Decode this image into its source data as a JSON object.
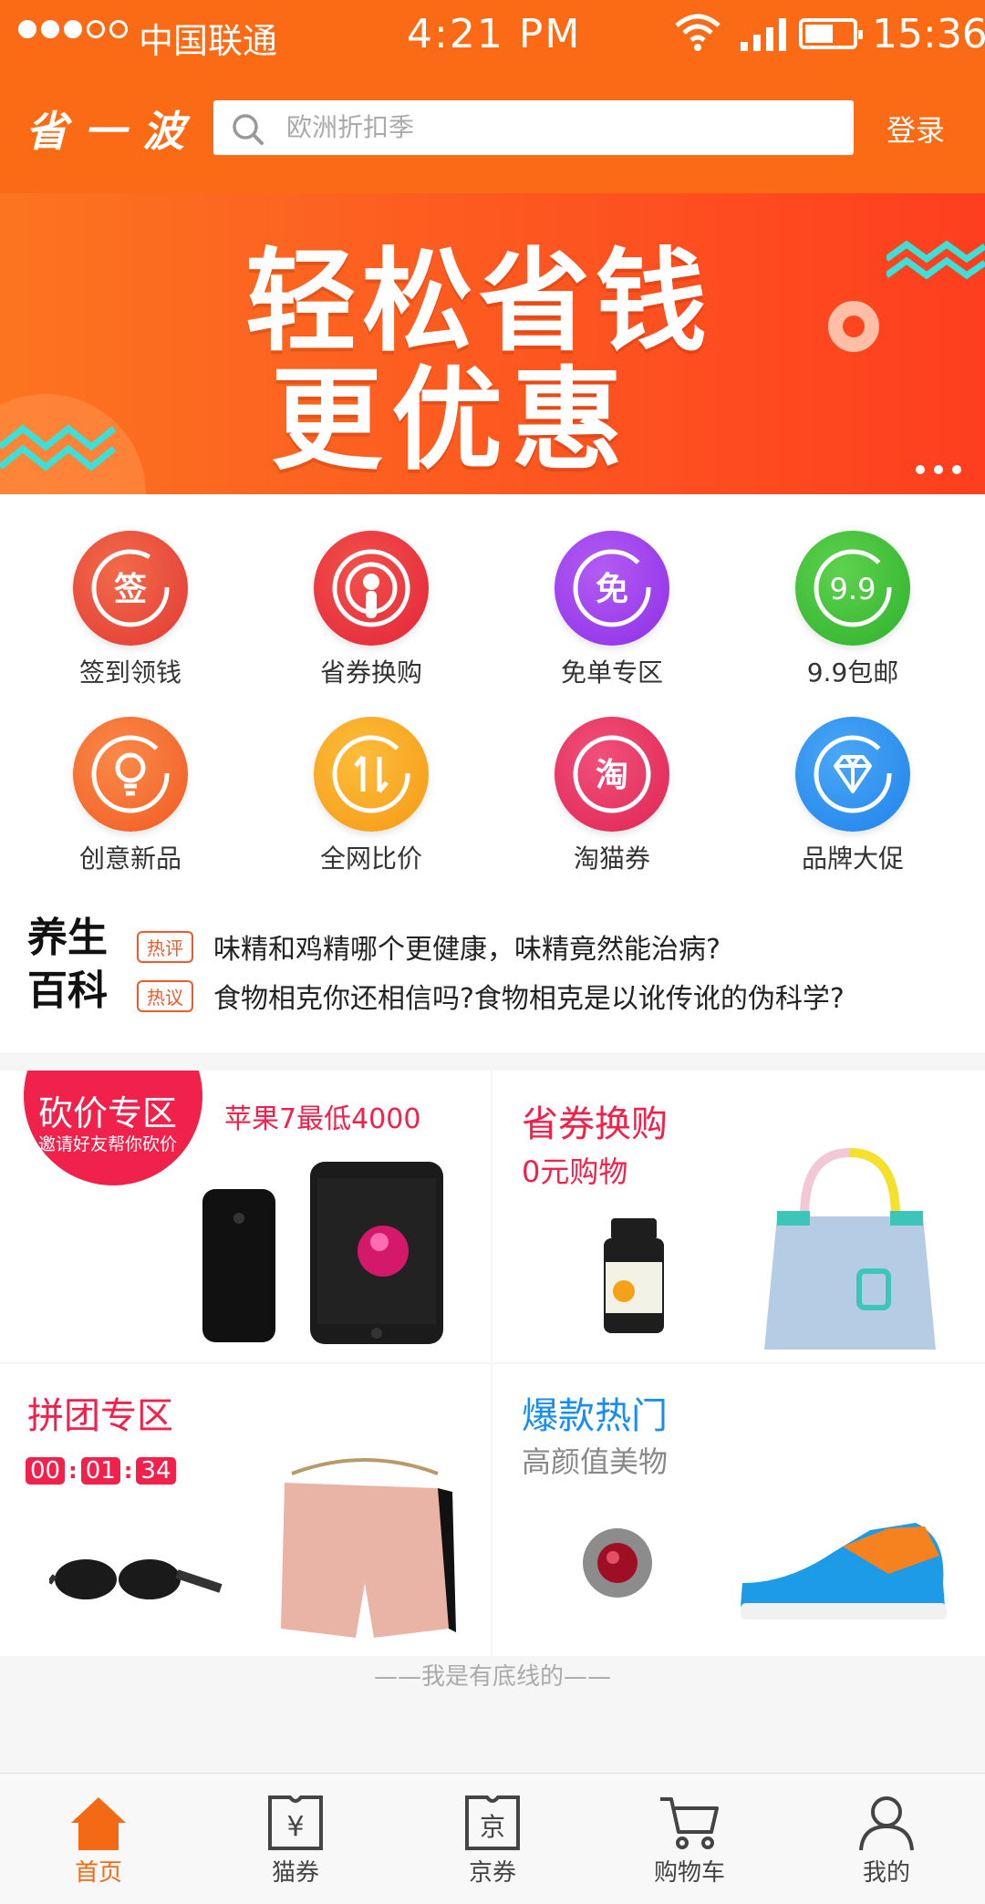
{
  "status": {
    "carrier": "中国联通",
    "time_center": "4:21 PM",
    "time_right": "15:36"
  },
  "header": {
    "logo": "省一波",
    "search_placeholder": "欧洲折扣季",
    "login": "登录"
  },
  "banner": {
    "line1": "轻松省钱",
    "line2": "更优惠",
    "slides": 3
  },
  "grid": [
    {
      "label": "签到领钱",
      "icon": "sign-icon",
      "color": "#e8413b"
    },
    {
      "label": "省券换购",
      "icon": "podcast-icon",
      "color": "#e9303a"
    },
    {
      "label": "免单专区",
      "icon": "free-icon",
      "color": "#a03ef0"
    },
    {
      "label": "9.9包邮",
      "icon": "nine-nine-icon",
      "color": "#3fbe3a"
    },
    {
      "label": "创意新品",
      "icon": "bulb-icon",
      "color": "#f4662c"
    },
    {
      "label": "全网比价",
      "icon": "compare-icon",
      "color": "#f8a21c"
    },
    {
      "label": "淘猫券",
      "icon": "tao-icon",
      "color": "#e52f62"
    },
    {
      "label": "品牌大促",
      "icon": "diamond-icon",
      "color": "#2b8ff0"
    }
  ],
  "news": {
    "title1": "养生",
    "title2": "百科",
    "items": [
      {
        "tag": "热评",
        "text": "味精和鸡精哪个更健康，味精竟然能治病?"
      },
      {
        "tag": "热议",
        "text": "食物相克你还相信吗?食物相克是以讹传讹的伪科学?"
      }
    ]
  },
  "promos": {
    "bargain": {
      "badge_title": "砍价专区",
      "badge_sub": "邀请好友帮你砍价",
      "subtitle": "苹果7最低4000"
    },
    "exchange": {
      "title": "省券换购",
      "subtitle": "0元购物"
    },
    "group": {
      "title": "拼团专区",
      "timer": [
        "00",
        "01",
        "34"
      ]
    },
    "hot": {
      "title": "爆款热门",
      "subtitle": "高颜值美物"
    }
  },
  "footer_text": "——我是有底线的——",
  "tabs": [
    {
      "label": "首页",
      "icon": "home-icon",
      "active": true
    },
    {
      "label": "猫券",
      "icon": "coupon-yuan-icon",
      "active": false
    },
    {
      "label": "京券",
      "icon": "coupon-jing-icon",
      "active": false
    },
    {
      "label": "购物车",
      "icon": "cart-icon",
      "active": false
    },
    {
      "label": "我的",
      "icon": "user-icon",
      "active": false
    }
  ],
  "colors": {
    "brand": "#fb6a14",
    "accent_red": "#f0214a",
    "hot_blue": "#1a8df0"
  }
}
